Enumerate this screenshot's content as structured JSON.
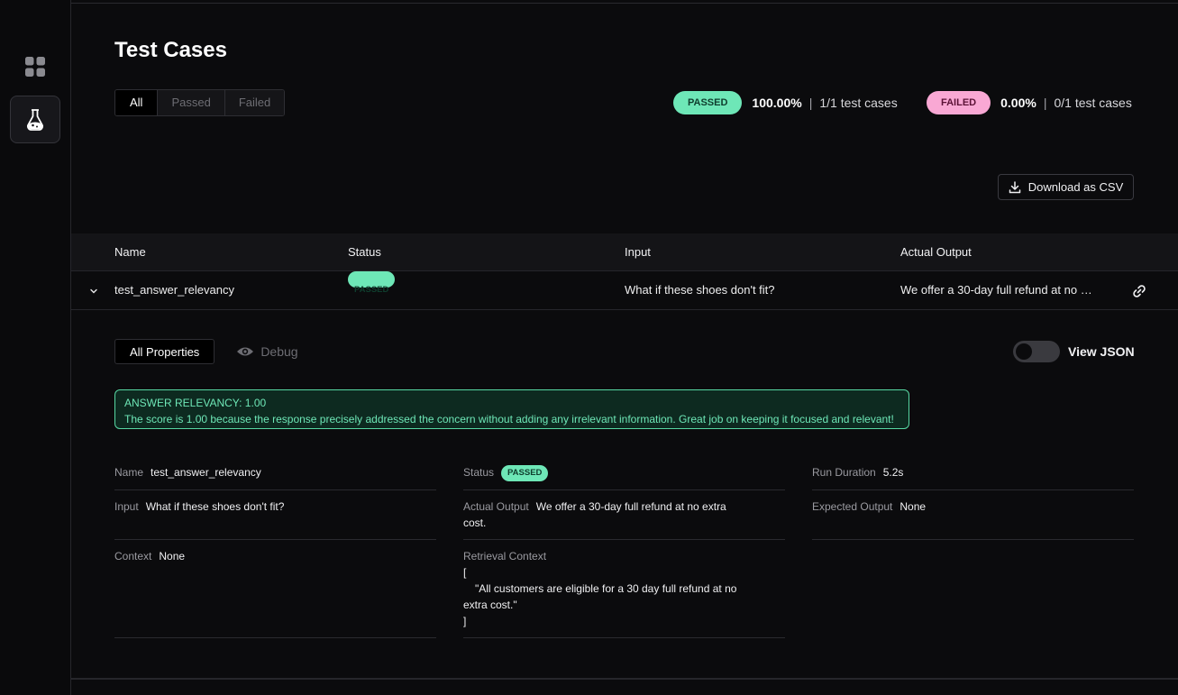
{
  "page": {
    "title": "Test Cases"
  },
  "filters": [
    "All",
    "Passed",
    "Failed"
  ],
  "summary": {
    "passed": {
      "label": "PASSED",
      "percent": "100.00%",
      "separator": "|",
      "count": "1/1 test cases"
    },
    "failed": {
      "label": "FAILED",
      "percent": "0.00%",
      "separator": "|",
      "count": "0/1 test cases"
    }
  },
  "download": {
    "label": "Download as CSV"
  },
  "table": {
    "headers": [
      "Name",
      "Status",
      "Input",
      "Actual Output"
    ],
    "row": {
      "name": "test_answer_relevancy",
      "status": "PASSED",
      "input": "What if these shoes don't fit?",
      "actual_output": "We offer a 30-day full refund at no …"
    }
  },
  "detail_tabs": {
    "all": "All Properties",
    "debug": "Debug"
  },
  "view_json": {
    "label": "View JSON",
    "enabled": false
  },
  "metric": {
    "title": "ANSWER RELEVANCY: 1.00",
    "reason": "The score is 1.00 because the response precisely addressed the concern without adding any irrelevant information. Great job on keeping it focused and relevant!"
  },
  "properties": {
    "name": {
      "key": "Name",
      "value": "test_answer_relevancy"
    },
    "status": {
      "key": "Status",
      "value": "PASSED"
    },
    "run_duration": {
      "key": "Run Duration",
      "value": "5.2s"
    },
    "input": {
      "key": "Input",
      "value": "What if these shoes don't fit?"
    },
    "actual_output": {
      "key": "Actual Output",
      "value_line1": "We offer a 30-day full refund at no extra",
      "value_line2": "cost."
    },
    "expected_output": {
      "key": "Expected Output",
      "value": "None"
    },
    "context": {
      "key": "Context",
      "value": "None"
    },
    "retrieval_context": {
      "key": "Retrieval Context",
      "line1": "[",
      "line2": "\"All customers are eligible for a 30 day full refund at no",
      "line3": "extra cost.\"",
      "line4": "]"
    }
  },
  "colors": {
    "passed": "#6ee7b7",
    "failed": "#f9a8d4",
    "background": "#0b0b0d"
  },
  "icons": {
    "sidebar_dashboard": "grid-icon",
    "sidebar_tests": "flask-icon",
    "download": "download-icon",
    "row_link": "link-icon",
    "expand": "chevron-down-icon",
    "debug": "eye-icon"
  }
}
